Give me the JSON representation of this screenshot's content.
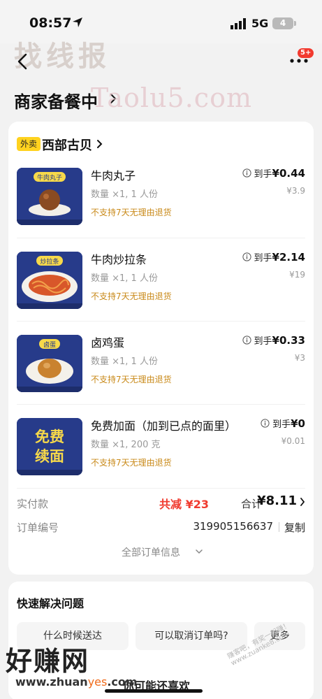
{
  "status_bar": {
    "time": "08:57",
    "network": "5G",
    "battery": "4"
  },
  "watermarks": {
    "top": "找线报",
    "mid": "Taolu5.com",
    "bottom": "好赚网",
    "url_prefix": "www.zhuan",
    "url_accent": "yes",
    "url_suffix": ".com",
    "diagonal": "赚客吧，有奖一起赚！www.zuanke8.com"
  },
  "header": {
    "message_badge": "5+",
    "title": "商家备餐中"
  },
  "store": {
    "tag": "外卖",
    "name": "西部古贝"
  },
  "items": [
    {
      "name": "牛肉丸子",
      "qty": "数量 ×1, 1 人份",
      "policy": "不支持7天无理由退货",
      "price_label": "到手",
      "price": "¥0.44",
      "orig_price": "¥3.9",
      "thumb_label": "牛肉丸子"
    },
    {
      "name": "牛肉炒拉条",
      "qty": "数量 ×1, 1 人份",
      "policy": "不支持7天无理由退货",
      "price_label": "到手",
      "price": "¥2.14",
      "orig_price": "¥19",
      "thumb_label": "炒拉条"
    },
    {
      "name": "卤鸡蛋",
      "qty": "数量 ×1, 1 人份",
      "policy": "不支持7天无理由退货",
      "price_label": "到手",
      "price": "¥0.33",
      "orig_price": "¥3",
      "thumb_label": "卤蛋"
    },
    {
      "name": "免费加面（加到已点的面里）",
      "qty": "数量 ×1, 200 克",
      "policy": "不支持7天无理由退货",
      "price_label": "到手",
      "price": "¥0",
      "orig_price": "¥0.01",
      "thumb_label_1": "免费",
      "thumb_label_2": "续面"
    }
  ],
  "summary": {
    "paid_label": "实付款",
    "discount": "共减 ¥23",
    "total_label": "合计",
    "total": "¥8.11",
    "order_label": "订单编号",
    "order_no": "319905156637",
    "copy": "复制",
    "all_info": "全部订单信息"
  },
  "quick": {
    "title": "快速解决问题",
    "buttons": [
      "什么时候送达",
      "可以取消订单吗?",
      "更多"
    ],
    "teaser": "你可能还喜欢"
  },
  "colors": {
    "accent_red": "#f03a2e",
    "policy_orange": "#c98a1a",
    "tag_yellow": "#ffd21f",
    "thumb_blue": "#273b8a"
  }
}
